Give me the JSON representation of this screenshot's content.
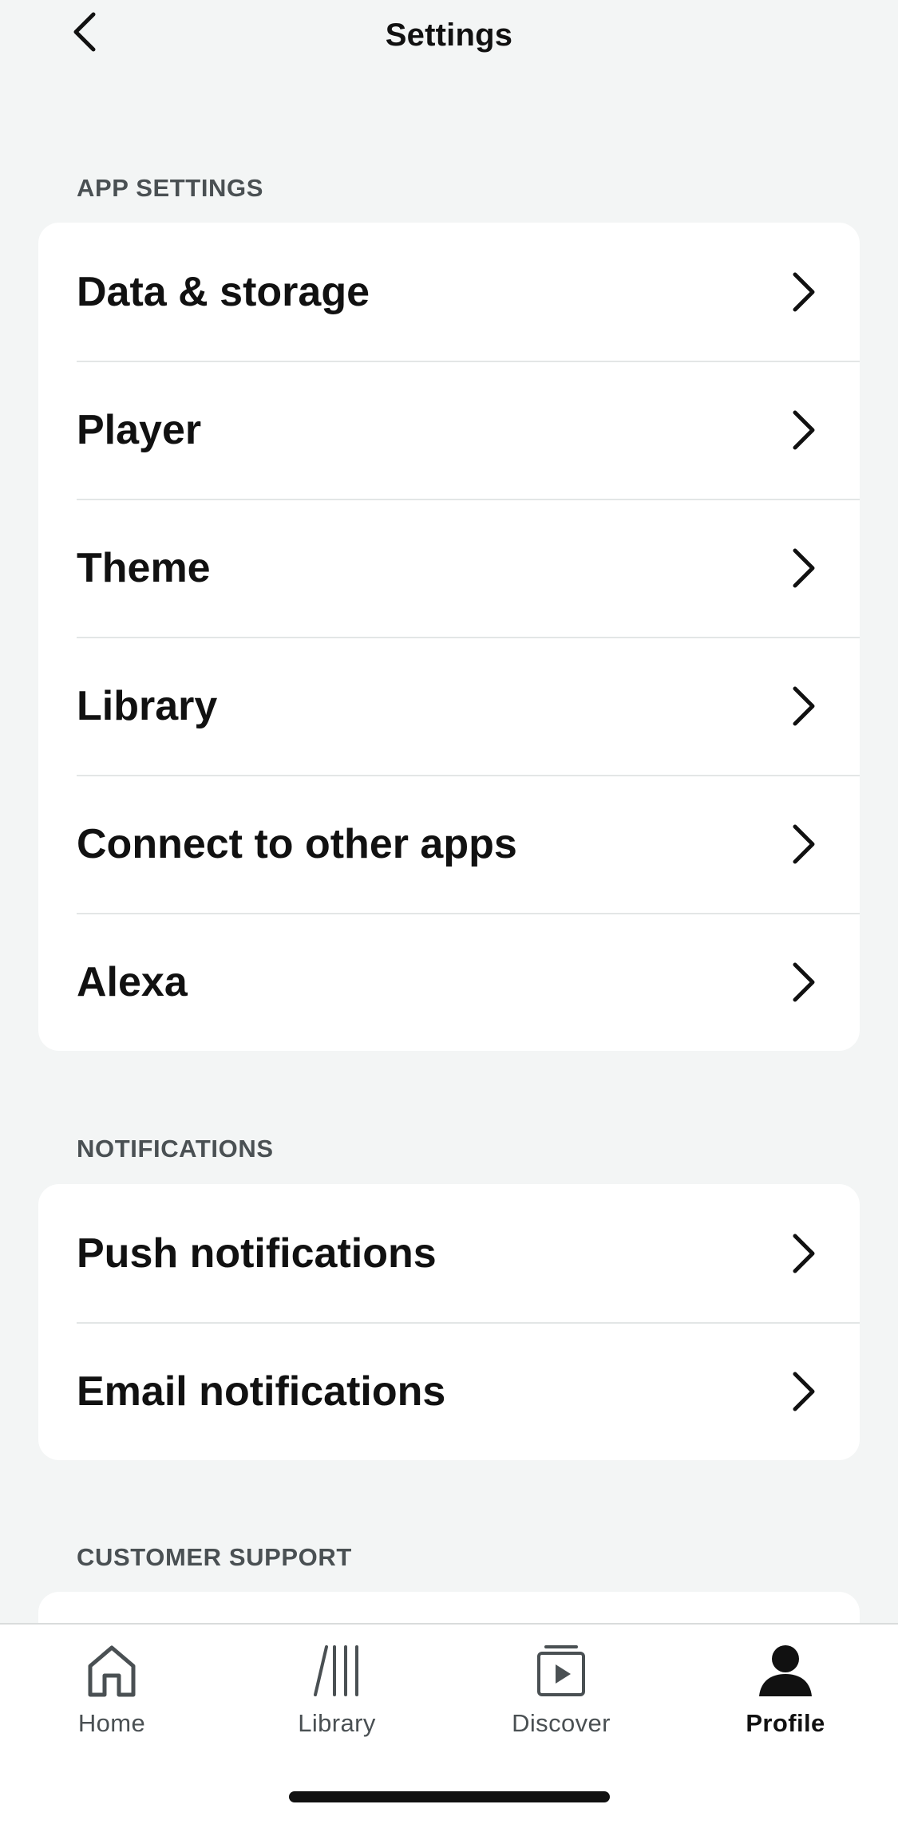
{
  "header": {
    "title": "Settings",
    "back_icon": "chevron-left-icon"
  },
  "sections": {
    "app_settings": {
      "label": "APP SETTINGS",
      "items": [
        {
          "label": "Data & storage"
        },
        {
          "label": "Player"
        },
        {
          "label": "Theme"
        },
        {
          "label": "Library"
        },
        {
          "label": "Connect to other apps"
        },
        {
          "label": "Alexa"
        }
      ]
    },
    "notifications": {
      "label": "NOTIFICATIONS",
      "items": [
        {
          "label": "Push notifications"
        },
        {
          "label": "Email notifications"
        }
      ]
    },
    "customer_support": {
      "label": "CUSTOMER SUPPORT"
    }
  },
  "tabbar": {
    "tabs": [
      {
        "label": "Home",
        "icon": "home-icon",
        "active": false
      },
      {
        "label": "Library",
        "icon": "library-icon",
        "active": false
      },
      {
        "label": "Discover",
        "icon": "discover-icon",
        "active": false
      },
      {
        "label": "Profile",
        "icon": "profile-icon",
        "active": true
      }
    ]
  },
  "colors": {
    "background": "#f3f5f5",
    "card": "#ffffff",
    "text": "#111111",
    "muted": "#4a5053",
    "divider": "#e3e6e6"
  }
}
